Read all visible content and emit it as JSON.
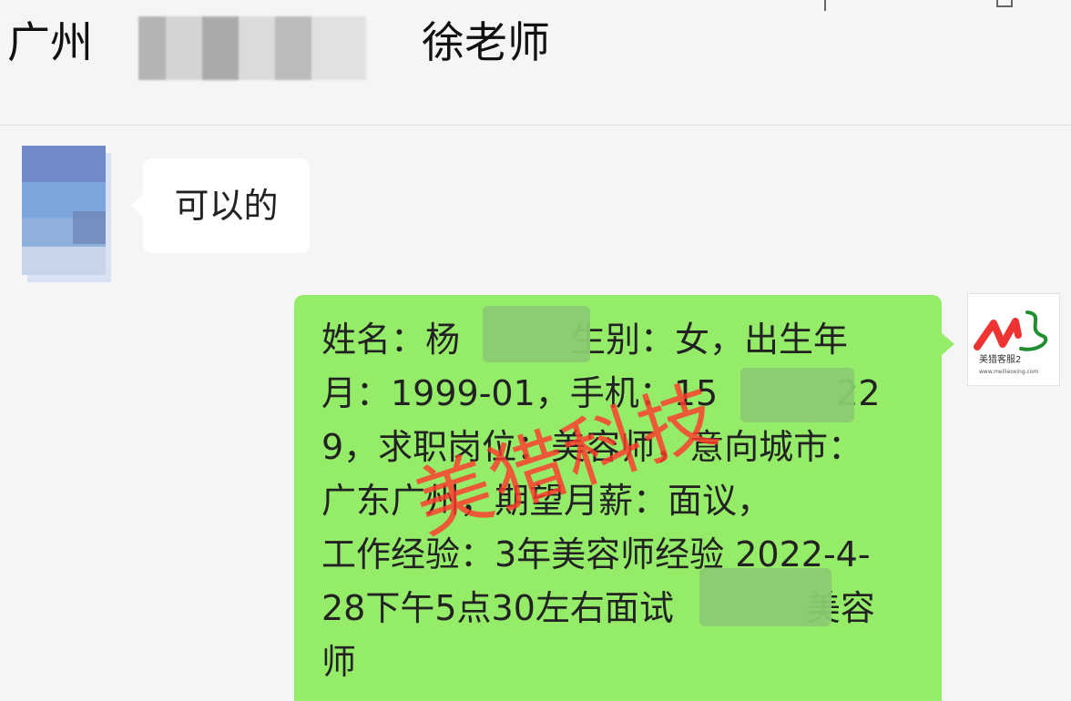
{
  "header": {
    "title_left": "广州",
    "title_right": "徐老师"
  },
  "messages": {
    "incoming": "可以的",
    "outgoing_lines": [
      "姓名：杨",
      "生别：女，出生年",
      "月：1999-01，手机：15",
      "22",
      "9，求职岗位：美容师，意向城市：",
      "广东广州，期望月薪：面议，",
      "工作经验：3年美容师经验 2022-4-",
      "28下午5点30左右面试",
      "美容",
      "师"
    ]
  },
  "watermark": {
    "text": "美猎科技"
  },
  "logo": {
    "lines": [
      "美猎客服2",
      "www.meilieoxing.com"
    ]
  },
  "colors": {
    "background": "#f5f5f5",
    "incoming_bubble": "#ffffff",
    "outgoing_bubble": "#95ec69",
    "watermark": "#ff3a2d"
  }
}
